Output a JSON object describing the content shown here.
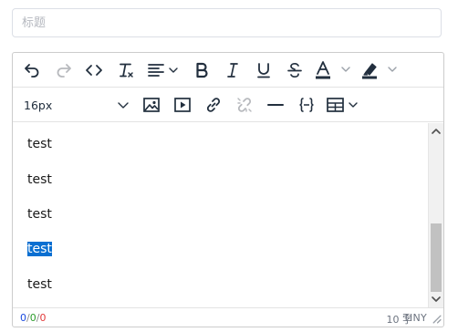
{
  "title_field": {
    "placeholder": "标题",
    "value": ""
  },
  "toolbar": {
    "font_size": "16px"
  },
  "content": {
    "paragraphs": [
      "test",
      "test",
      "test",
      "test",
      "test"
    ],
    "selected_index": 3
  },
  "status": {
    "count_a": "0",
    "count_b": "0",
    "count_c": "0",
    "separator": "/",
    "word_count": "10 字",
    "brand": "TINY"
  },
  "colors": {
    "selection": "#0a6fd1",
    "count_a": "#1c4be0",
    "count_b": "#2e9e2e",
    "count_c": "#e23a3a"
  }
}
